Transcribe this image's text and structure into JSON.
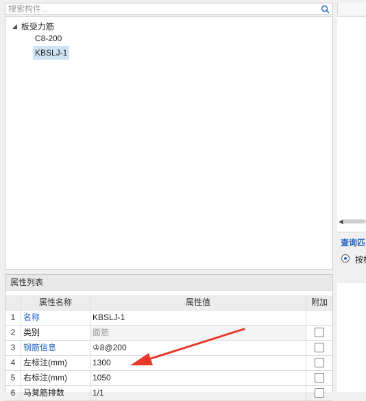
{
  "search": {
    "placeholder": "搜索构件..."
  },
  "tree": {
    "root_label": "板受力筋",
    "children": [
      {
        "label": "C8-200",
        "selected": false
      },
      {
        "label": "KBSLJ-1",
        "selected": true
      }
    ]
  },
  "properties": {
    "title": "属性列表",
    "headers": {
      "name": "属性名称",
      "value": "属性值",
      "extra": "附加"
    },
    "rows": [
      {
        "num": "1",
        "name": "名称",
        "value": "KBSLJ-1",
        "link": true,
        "checkbox": false
      },
      {
        "num": "2",
        "name": "类别",
        "value": "面筋",
        "link": false,
        "checkbox": true
      },
      {
        "num": "3",
        "name": "钢筋信息",
        "value": "♔8@200",
        "link": true,
        "checkbox": true
      },
      {
        "num": "4",
        "name": "左标注(mm)",
        "value": "1300",
        "link": false,
        "checkbox": true
      },
      {
        "num": "5",
        "name": "右标注(mm)",
        "value": "1050",
        "link": false,
        "checkbox": true
      },
      {
        "num": "6",
        "name": "马凳筋排数",
        "value": "1/1",
        "link": false,
        "checkbox": true
      }
    ]
  },
  "right_panel": {
    "query_label": "查询匹",
    "radio_label": "按构"
  },
  "colors": {
    "link": "#2565c4",
    "selection": "#cfe3f6",
    "annotation_arrow": "#e8392a"
  }
}
